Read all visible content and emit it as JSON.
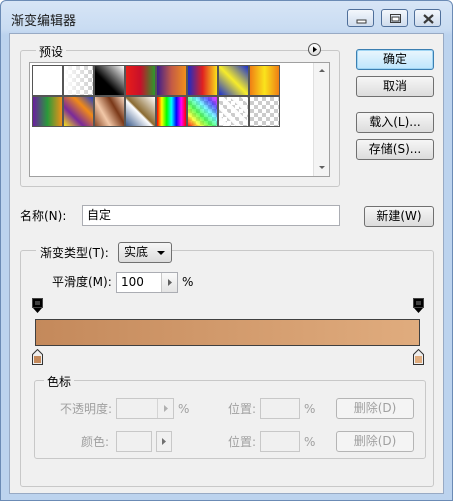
{
  "window": {
    "title": "渐变编辑器",
    "controls": [
      "minimize-icon",
      "maximize-icon",
      "close-icon"
    ]
  },
  "presets": {
    "label": "预设",
    "menu_icon": "play-menu-icon",
    "swatches": [
      {
        "name": "foreground-to-background"
      },
      {
        "name": "foreground-to-transparent"
      },
      {
        "name": "black-white"
      },
      {
        "name": "red-green"
      },
      {
        "name": "violet-orange"
      },
      {
        "name": "blue-red-yellow"
      },
      {
        "name": "blue-yellow-blue"
      },
      {
        "name": "orange-yellow-orange"
      },
      {
        "name": "violet-green-orange"
      },
      {
        "name": "yellow-violet-orange-blue"
      },
      {
        "name": "copper"
      },
      {
        "name": "chrome"
      },
      {
        "name": "spectrum"
      },
      {
        "name": "transparent-rainbow"
      },
      {
        "name": "transparent-stripes"
      },
      {
        "name": "neutral-density"
      }
    ]
  },
  "buttons": {
    "ok": "确定",
    "cancel": "取消",
    "load": "载入(L)...",
    "save": "存储(S)...",
    "new": "新建(W)"
  },
  "name_field": {
    "label": "名称(N):",
    "value": "自定"
  },
  "gradient_type": {
    "label": "渐变类型(T):",
    "value": "实底"
  },
  "smoothness": {
    "label": "平滑度(M):",
    "value": "100",
    "unit": "%"
  },
  "gradient": {
    "start_color": "#c4895b",
    "end_color": "#e0ac7e",
    "opacity_stop_color": "#000000"
  },
  "stops": {
    "label": "色标",
    "opacity_label": "不透明度:",
    "opacity_unit": "%",
    "location_label": "位置:",
    "location_unit": "%",
    "delete_label": "删除(D)",
    "color_label": "颜色:",
    "color_location_label": "位置:",
    "color_location_unit": "%",
    "color_delete_label": "删除(D)"
  }
}
